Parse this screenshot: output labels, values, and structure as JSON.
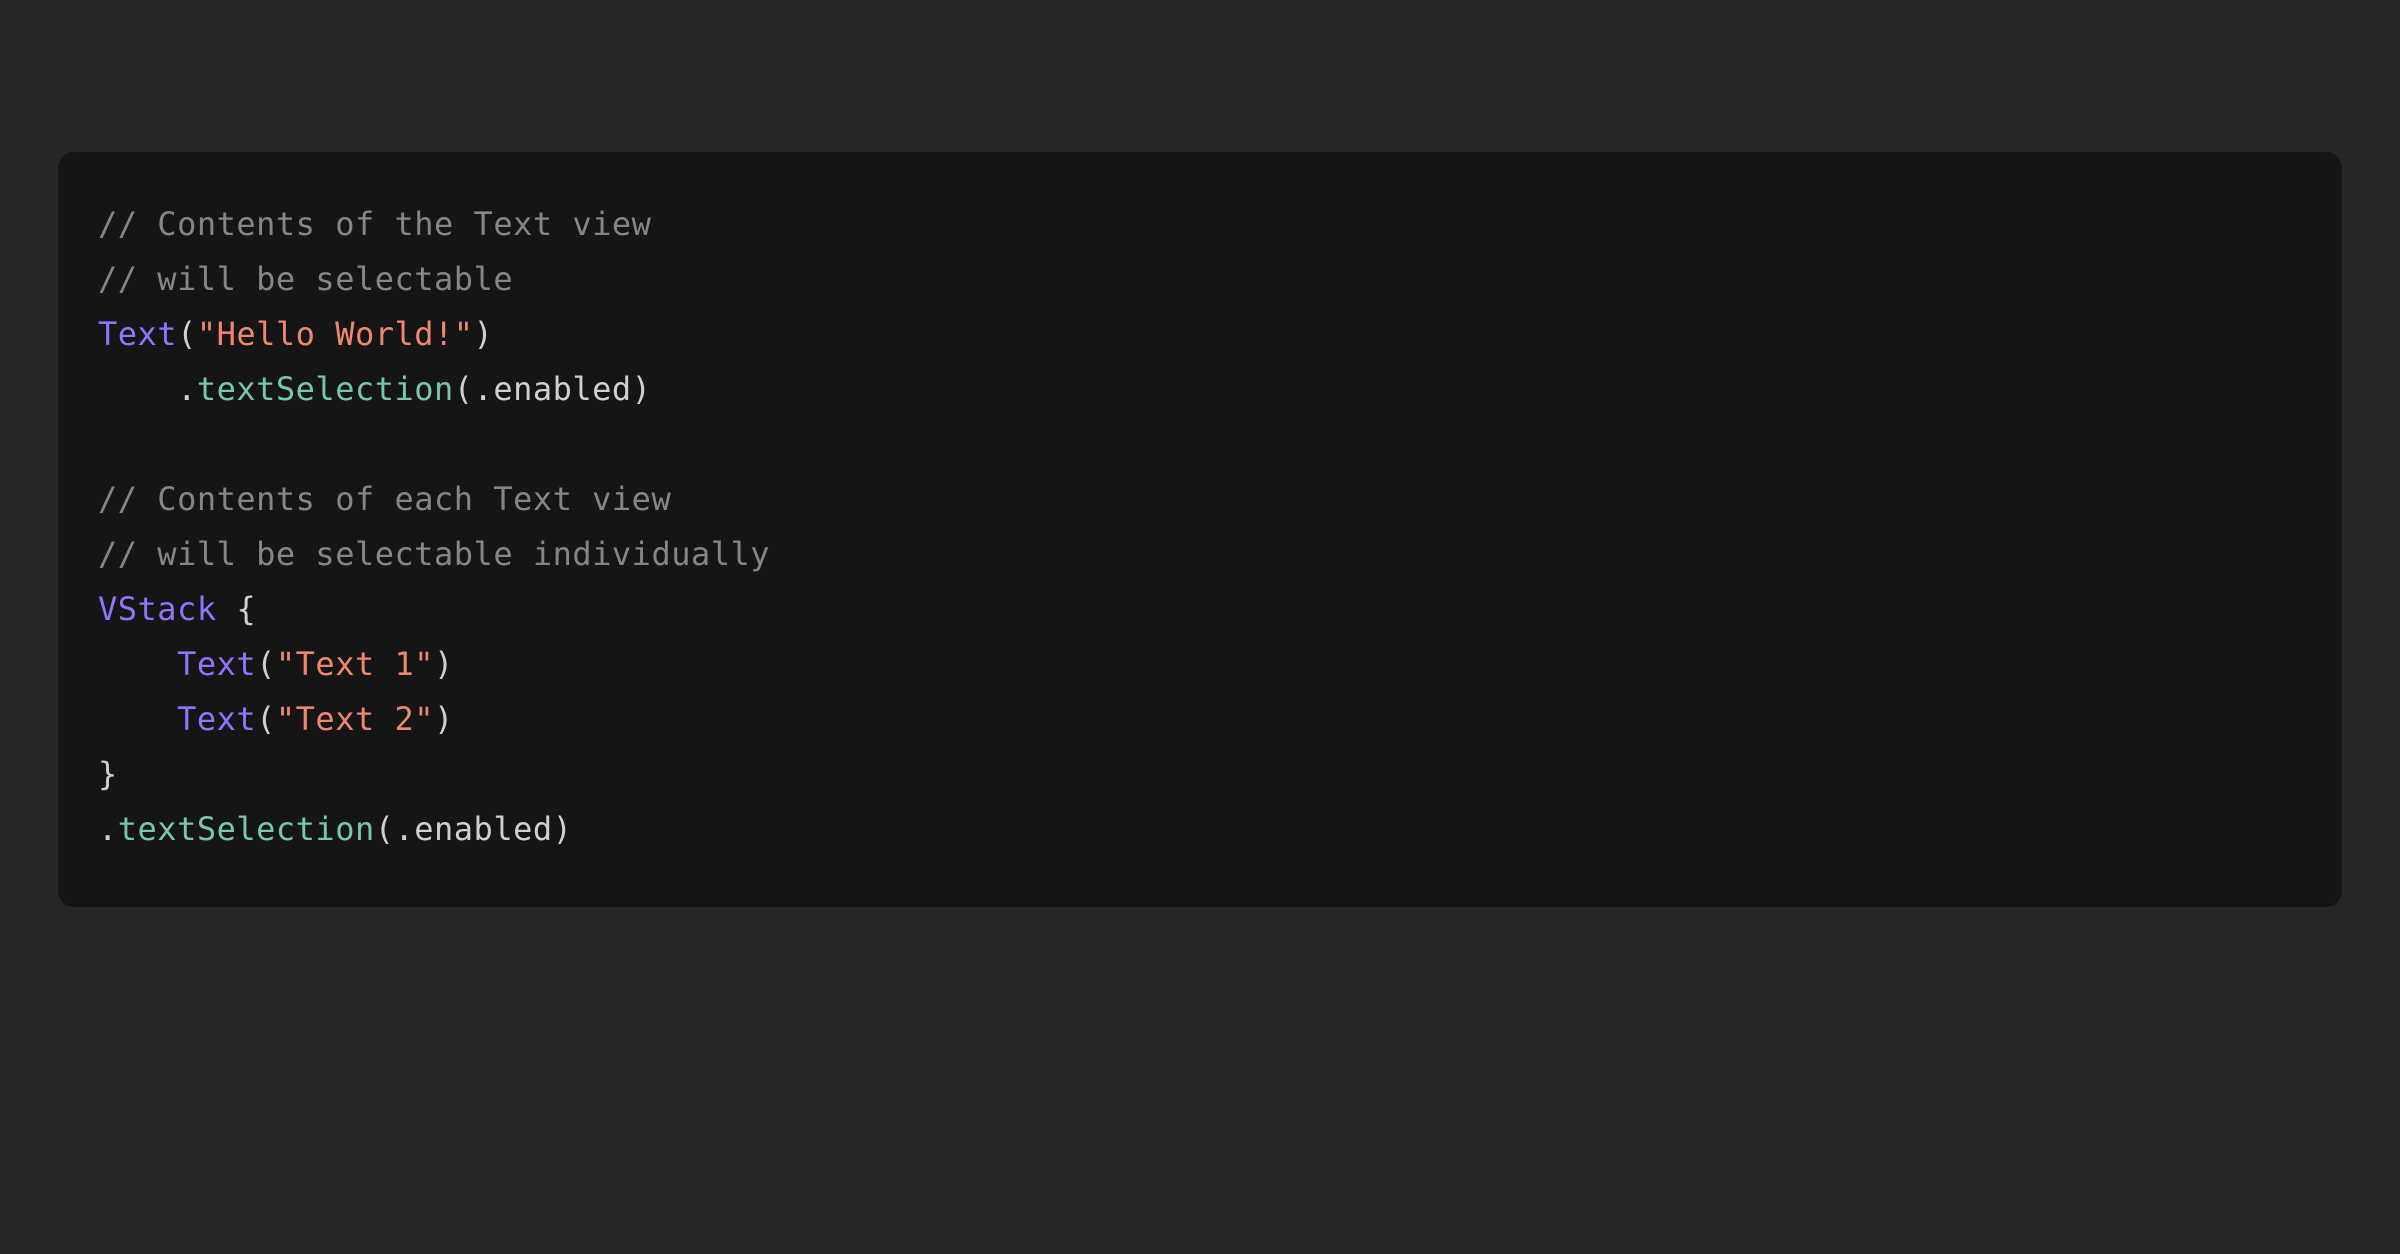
{
  "code": {
    "comment1_line1": "// Contents of the Text view",
    "comment1_line2": "// will be selectable",
    "type_text_1": "Text",
    "paren_open": "(",
    "paren_close": ")",
    "string_hello": "\"Hello World!\"",
    "indent4": "    ",
    "dot": ".",
    "method_textSelection": "textSelection",
    "arg_enabled": ".enabled",
    "blank": "",
    "comment2_line1": "// Contents of each Text view",
    "comment2_line2": "// will be selectable individually",
    "type_vstack": "VStack",
    "space_brace": " {",
    "type_text_2": "Text",
    "string_text1": "\"Text 1\"",
    "type_text_3": "Text",
    "string_text2": "\"Text 2\"",
    "brace_close": "}"
  }
}
